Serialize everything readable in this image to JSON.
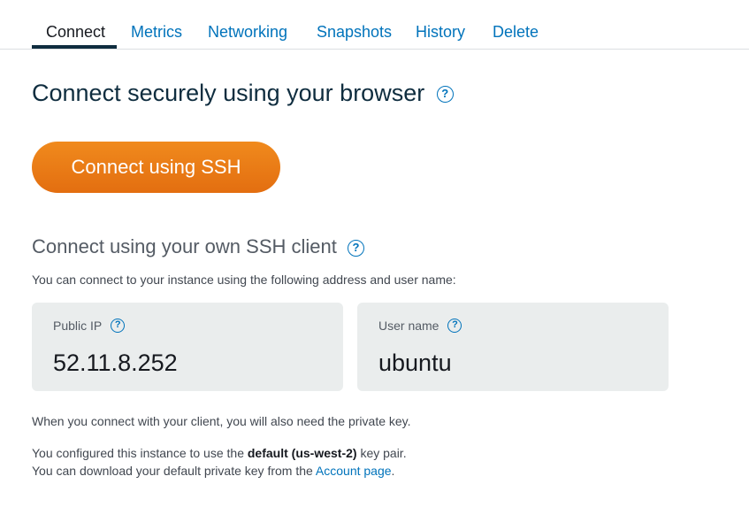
{
  "tabs": [
    "Connect",
    "Metrics",
    "Networking",
    "Snapshots",
    "History",
    "Delete"
  ],
  "active_tab": "Connect",
  "browser_section": {
    "heading": "Connect securely using your browser",
    "button_label": "Connect using SSH"
  },
  "client_section": {
    "heading": "Connect using your own SSH client",
    "intro": "You can connect to your instance using the following address and user name:"
  },
  "public_ip": {
    "label": "Public IP",
    "value": "52.11.8.252"
  },
  "user_name": {
    "label": "User name",
    "value": "ubuntu"
  },
  "notes": {
    "private_key": "When you connect with your client, you will also need the private key.",
    "configured_prefix": "You configured this instance to use the ",
    "key_pair": "default (us-west-2)",
    "configured_suffix": " key pair.",
    "download_prefix": "You can download your default private key from the ",
    "account_link": "Account page",
    "download_suffix": "."
  },
  "help_icon_text": "?",
  "colors": {
    "accent": "#0073bb",
    "button": "#ec7211",
    "card_bg": "#eaeded",
    "tab_underline": "#0f2d3f"
  }
}
